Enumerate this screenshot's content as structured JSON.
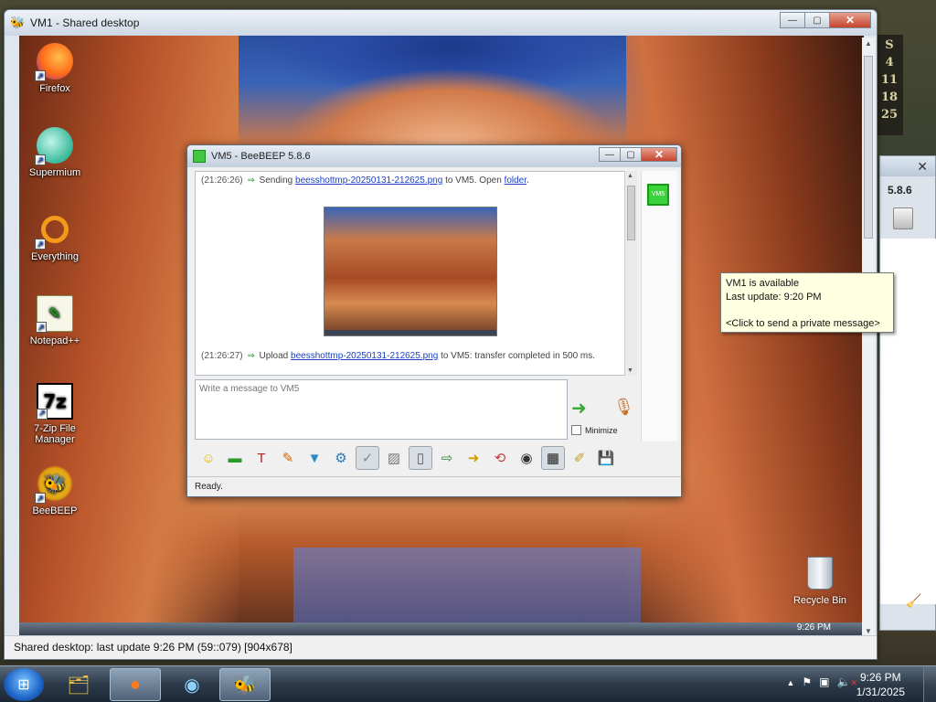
{
  "host": {
    "clock_strip": [
      "S",
      "4",
      "11",
      "18",
      "25"
    ],
    "side_window": {
      "close": "✕",
      "version": "5.8.6"
    },
    "taskbar": {
      "apps": [
        {
          "name": "explorer-icon",
          "glyph": "🗂"
        },
        {
          "name": "firefox-icon",
          "glyph": "●"
        },
        {
          "name": "supermium-icon",
          "glyph": "◉"
        },
        {
          "name": "beebeep-icon",
          "glyph": "🐝"
        }
      ],
      "tray": {
        "up_arrow": "▲",
        "flag": "⚑",
        "monitor": "▣",
        "volume": "🔈",
        "mute": "✕"
      },
      "time": "9:26 PM",
      "date": "1/31/2025"
    }
  },
  "vm_window": {
    "title": "VM1 - Shared desktop",
    "status": "Shared desktop: last update 9:26 PM (59::079) [904x678]",
    "controls": {
      "minimize": "—",
      "maximize": "▢",
      "close": "✕"
    }
  },
  "remote_desktop": {
    "icons": [
      {
        "label": "Firefox",
        "glyph": ""
      },
      {
        "label": "Supermium",
        "glyph": ""
      },
      {
        "label": "Everything",
        "glyph": ""
      },
      {
        "label": "Notepad++",
        "glyph": "✎"
      },
      {
        "label": "7-Zip File Manager",
        "glyph": "7z"
      },
      {
        "label": "BeeBEEP",
        "glyph": "🐝"
      }
    ],
    "recycle_bin": "Recycle Bin",
    "taskbar_clock": "9:26 PM"
  },
  "chat": {
    "title": "VM5 - BeeBEEP 5.8.6",
    "user_badge": "VM5",
    "messages": [
      {
        "time": "(21:26:26)",
        "prefix": "Sending",
        "link": "beesshottmp-20250131-212625.png",
        "middle": "to VM5. Open",
        "link2": "folder",
        "suffix": "."
      },
      {
        "time": "(21:26:27)",
        "prefix": "Upload",
        "link": "beesshottmp-20250131-212625.png",
        "suffix": "to VM5: transfer completed in 500 ms."
      }
    ],
    "compose_placeholder": "Write a message to VM5",
    "minimize_label": "Minimize",
    "status": "Ready.",
    "toolbar": [
      {
        "name": "emoticons-button",
        "glyph": "☺",
        "color": "#e8b800"
      },
      {
        "name": "color-button",
        "glyph": "▬",
        "color": "#2a9a2a"
      },
      {
        "name": "font-button",
        "glyph": "T",
        "color": "#c02020"
      },
      {
        "name": "spellcheck-button",
        "glyph": "✎",
        "color": "#d06a00"
      },
      {
        "name": "filter-button",
        "glyph": "▼",
        "color": "#2a8ac8"
      },
      {
        "name": "settings-button",
        "glyph": "⚙",
        "color": "#2a7ac0"
      },
      {
        "name": "bold-button",
        "glyph": "✓",
        "color": "#888888"
      },
      {
        "name": "image-button",
        "glyph": "▨",
        "color": "#777777"
      },
      {
        "name": "send-file-button",
        "glyph": "▯",
        "color": "#555555"
      },
      {
        "name": "save-chat-button",
        "glyph": "⇨",
        "color": "#2a8a2a"
      },
      {
        "name": "send-folder-button",
        "glyph": "➜",
        "color": "#d0a000"
      },
      {
        "name": "clear-button",
        "glyph": "⟲",
        "color": "#c04040"
      },
      {
        "name": "screenshot-button",
        "glyph": "◉",
        "color": "#333333"
      },
      {
        "name": "share-desktop-button",
        "glyph": "▦",
        "color": "#222222"
      },
      {
        "name": "edit-button",
        "glyph": "✐",
        "color": "#c89a20"
      },
      {
        "name": "save-button",
        "glyph": "💾",
        "color": "#2a5ac0"
      }
    ]
  },
  "tooltip": {
    "line1": "VM1 is available",
    "line2": "Last update: 9:20 PM",
    "line3": "<Click to send a private message>"
  }
}
